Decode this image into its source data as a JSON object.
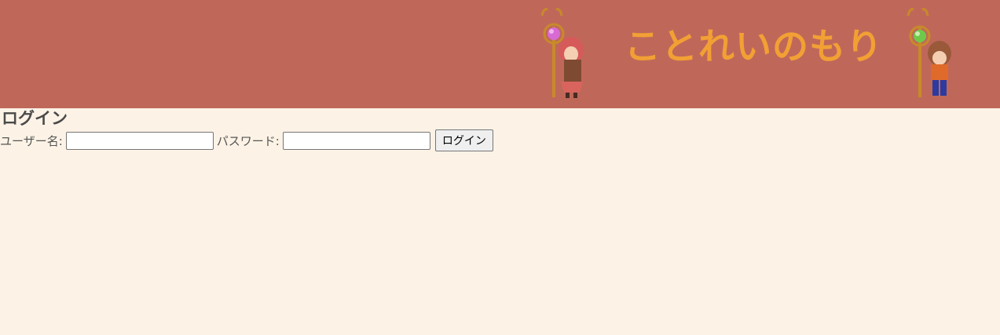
{
  "header": {
    "site_title": "ことれいのもり",
    "colors": {
      "banner_bg": "#bf685a",
      "title": "#f2a034",
      "page_bg": "#fcf3e6"
    }
  },
  "login": {
    "heading": "ログイン",
    "username_label": "ユーザー名:",
    "username_value": "",
    "password_label": "パスワード:",
    "password_value": "",
    "submit_label": "ログイン"
  }
}
